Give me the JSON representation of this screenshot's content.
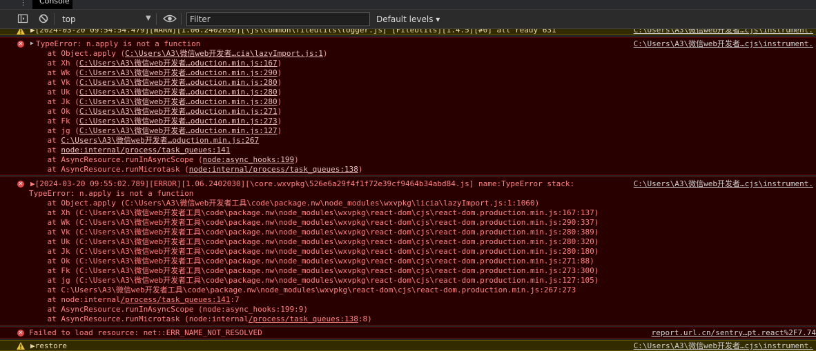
{
  "tabs": {
    "more_label": "⋮",
    "console_label": "Console"
  },
  "toolbar": {
    "context": "top",
    "filter_placeholder": "Filter",
    "levels_label": "Default levels ▾",
    "icons": [
      "sidebar-toggle-icon",
      "clear-console-icon",
      "live-expression-eye-icon"
    ]
  },
  "colors": {
    "warn_bg": "#332b00",
    "error_bg": "#290000",
    "error_text": "#ff8080",
    "error_icon": "#e34646",
    "warn_icon": "#e8c13c"
  },
  "messages": {
    "warn_top": {
      "text": "▶[2024-03-20 09:54:54.479][WARN][1.06.2402030][\\js\\common\\fileutils\\logger.js] [FileUtils][1.4.5][#0] all ready 631",
      "source": "C:\\Users\\A3\\微信web开发者…cjs\\instrument."
    },
    "error1": {
      "head": "TypeError: n.apply is not a function",
      "source": "C:\\Users\\A3\\微信web开发者…cjs\\instrument.",
      "frames": [
        {
          "pre": "    at Object.apply (",
          "link": "C:\\Users\\A3\\微信web开发者…cia\\lazyImport.js:1",
          "post": ")"
        },
        {
          "pre": "    at Xh (",
          "link": "C:\\Users\\A3\\微信web开发者…oduction.min.js:167",
          "post": ")"
        },
        {
          "pre": "    at Wk (",
          "link": "C:\\Users\\A3\\微信web开发者…oduction.min.js:290",
          "post": ")"
        },
        {
          "pre": "    at Vk (",
          "link": "C:\\Users\\A3\\微信web开发者…oduction.min.js:280",
          "post": ")"
        },
        {
          "pre": "    at Uk (",
          "link": "C:\\Users\\A3\\微信web开发者…oduction.min.js:280",
          "post": ")"
        },
        {
          "pre": "    at Jk (",
          "link": "C:\\Users\\A3\\微信web开发者…oduction.min.js:280",
          "post": ")"
        },
        {
          "pre": "    at Ok (",
          "link": "C:\\Users\\A3\\微信web开发者…oduction.min.js:271",
          "post": ")"
        },
        {
          "pre": "    at Fk (",
          "link": "C:\\Users\\A3\\微信web开发者…oduction.min.js:273",
          "post": ")"
        },
        {
          "pre": "    at jg (",
          "link": "C:\\Users\\A3\\微信web开发者…oduction.min.js:127",
          "post": ")"
        },
        {
          "pre": "    at ",
          "link": "C:\\Users\\A3\\微信web开发者…oduction.min.js:267",
          "post": ""
        },
        {
          "pre": "    at ",
          "link": "node:internal/process/task_queues:141",
          "post": ""
        },
        {
          "pre": "    at AsyncResource.runInAsyncScope (",
          "link": "node:async_hooks:199",
          "post": ")"
        },
        {
          "pre": "    at AsyncResource.runMicrotask (",
          "link": "node:internal/process/task_queues:138",
          "post": ")"
        }
      ]
    },
    "error2": {
      "head": "▶[2024-03-20 09:55:02.789][ERROR][1.06.2402030][\\core.wxvpkg\\526e6a29f4f1f72e39cf9464b34abd84.js] name:TypeError stack:",
      "head2": "TypeError: n.apply is not a function",
      "source": "C:\\Users\\A3\\微信web开发者…cjs\\instrument.",
      "lines": [
        "    at Object.apply (C:\\Users\\A3\\微信web开发者工具\\code\\package.nw\\node_modules\\wxvpkg\\licia\\lazyImport.js:1:1060)",
        "    at Xh (C:\\Users\\A3\\微信web开发者工具\\code\\package.nw\\node_modules\\wxvpkg\\react-dom\\cjs\\react-dom.production.min.js:167:137)",
        "    at Wk (C:\\Users\\A3\\微信web开发者工具\\code\\package.nw\\node_modules\\wxvpkg\\react-dom\\cjs\\react-dom.production.min.js:290:337)",
        "    at Vk (C:\\Users\\A3\\微信web开发者工具\\code\\package.nw\\node_modules\\wxvpkg\\react-dom\\cjs\\react-dom.production.min.js:280:389)",
        "    at Uk (C:\\Users\\A3\\微信web开发者工具\\code\\package.nw\\node_modules\\wxvpkg\\react-dom\\cjs\\react-dom.production.min.js:280:320)",
        "    at Jk (C:\\Users\\A3\\微信web开发者工具\\code\\package.nw\\node_modules\\wxvpkg\\react-dom\\cjs\\react-dom.production.min.js:280:180)",
        "    at Ok (C:\\Users\\A3\\微信web开发者工具\\code\\package.nw\\node_modules\\wxvpkg\\react-dom\\cjs\\react-dom.production.min.js:271:88)",
        "    at Fk (C:\\Users\\A3\\微信web开发者工具\\code\\package.nw\\node_modules\\wxvpkg\\react-dom\\cjs\\react-dom.production.min.js:273:300)",
        "    at jg (C:\\Users\\A3\\微信web开发者工具\\code\\package.nw\\node_modules\\wxvpkg\\react-dom\\cjs\\react-dom.production.min.js:127:105)",
        "    at C:\\Users\\A3\\微信web开发者工具\\code\\package.nw\\node_modules\\wxvpkg\\react-dom\\cjs\\react-dom.production.min.js:267:273"
      ],
      "tail": [
        {
          "pre": "    at node:internal",
          "link": "/process/task_queues:141",
          "post": ":7"
        },
        {
          "pre": "    at AsyncResource.runInAsyncScope (node:async_hooks:199:9)",
          "link": "",
          "post": ""
        },
        {
          "pre": "    at AsyncResource.runMicrotask (node:internal",
          "link": "/process/task_queues:138",
          "post": ":8)"
        }
      ]
    },
    "error3": {
      "text": "Failed to load resource: net::ERR_NAME_NOT_RESOLVED",
      "source": "report.url.cn/sentry…pt.react%2F7.74"
    },
    "warn_bottom": {
      "text": "▶restore",
      "source": "C:\\Users\\A3\\微信web开发者…cjs\\instrument."
    }
  }
}
